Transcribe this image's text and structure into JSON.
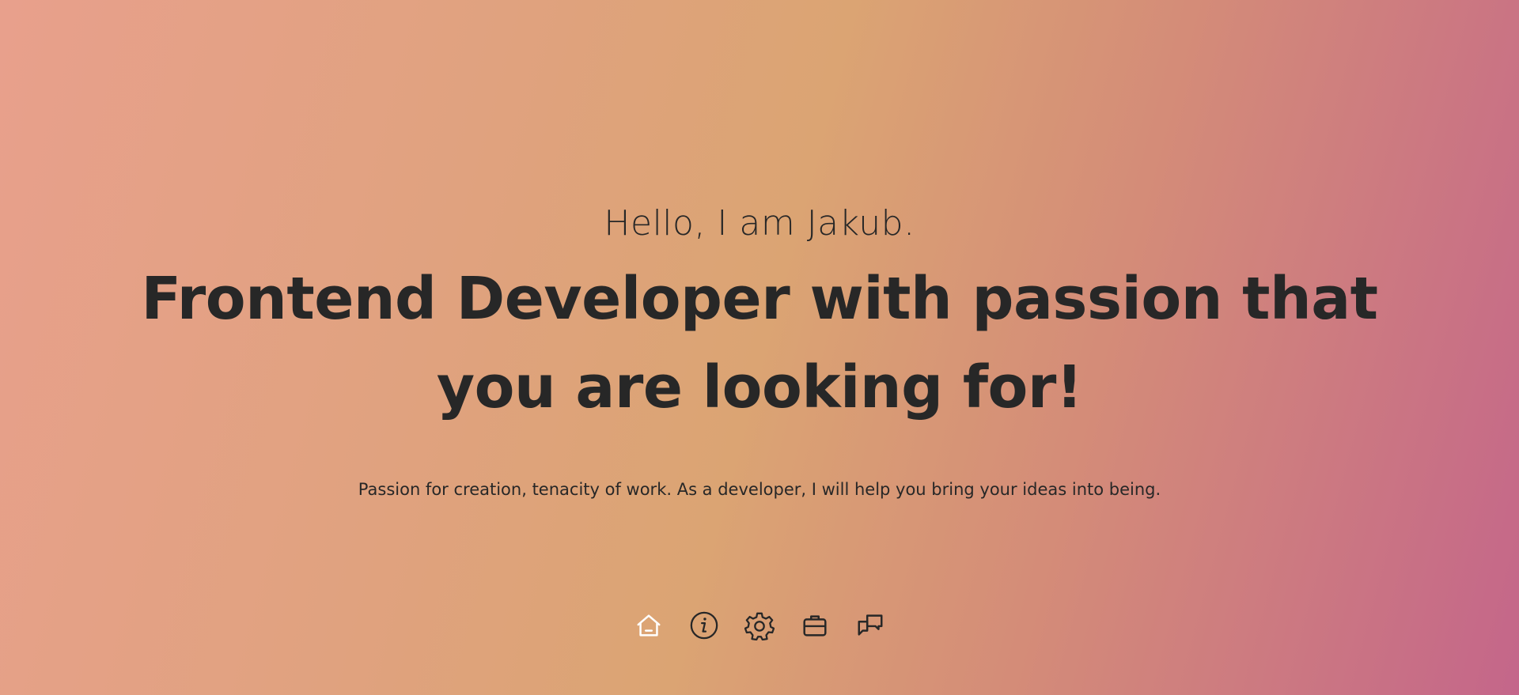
{
  "hero": {
    "greeting": "Hello, I am Jakub.",
    "headline": "Frontend Developer with passion that you are looking for!",
    "tagline": "Passion for creation, tenacity of work. As a developer, I will help you bring your ideas into being."
  },
  "nav": {
    "items": [
      {
        "icon": "home-icon",
        "active": true
      },
      {
        "icon": "info-icon",
        "active": false
      },
      {
        "icon": "gear-icon",
        "active": false
      },
      {
        "icon": "briefcase-icon",
        "active": false
      },
      {
        "icon": "chat-icon",
        "active": false
      }
    ]
  },
  "colors": {
    "text": "#272727",
    "active_icon": "#ffffff",
    "gradient_start": "#e8a08c",
    "gradient_mid": "#dba473",
    "gradient_end": "#c4668a"
  }
}
